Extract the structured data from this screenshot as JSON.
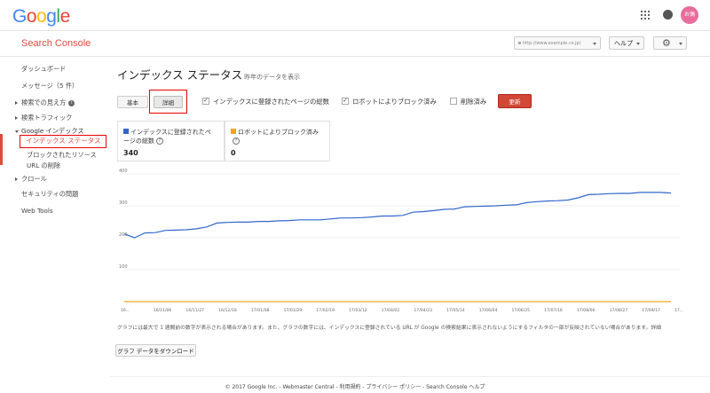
{
  "topbar": {
    "logo": [
      "G",
      "o",
      "o",
      "g",
      "l",
      "e"
    ],
    "logo_colors": [
      "#4285f4",
      "#ea4335",
      "#fbbc05",
      "#4285f4",
      "#34a853",
      "#ea4335"
    ],
    "avatar_text": "お偶"
  },
  "subbar": {
    "title": "Search Console",
    "site_selector": "http://www.example.co.jp/",
    "help_label": "ヘルプ"
  },
  "sidebar": {
    "items": [
      {
        "label": "ダッシュボード"
      },
      {
        "label": "メッセージ（5 件）"
      },
      {
        "label": "検索での見え方"
      },
      {
        "label": "検索トラフィック"
      },
      {
        "label": "Google インデックス"
      },
      {
        "label": "インデックス ステータス"
      },
      {
        "label": "ブロックされたリソース"
      },
      {
        "label": "URL の削除"
      },
      {
        "label": "クロール"
      },
      {
        "label": "セキュリティの問題"
      },
      {
        "label": "Web Tools"
      }
    ]
  },
  "main": {
    "title": "インデックス ステータス",
    "subtitle": "昨年のデータを表示",
    "tab_basic": "基本",
    "tab_detail": "詳細",
    "checkboxes": [
      {
        "label": "インデックスに登録されたページの総数",
        "checked": true
      },
      {
        "label": "ロボットによりブロック済み",
        "checked": true
      },
      {
        "label": "削除済み",
        "checked": false
      }
    ],
    "update_label": "更新",
    "legend": [
      {
        "label_line1": "インデックスに登録されたペ",
        "label_line2": "ージの総数",
        "value": "340",
        "color": "#3366cc"
      },
      {
        "label_line1": "ロボットによりブロック済み",
        "label_line2": "",
        "value": "0",
        "color": "#f4a31a"
      }
    ],
    "note": "グラフには最大で 1 週間前の数字が表示される場合があります。また、グラフの数字には、インデックスに登録されている URL が Google の検索結果に表示されないようにするフィルタの一部が反映されていない場合があります。詳細",
    "download_label": "グラフ データをダウンロード"
  },
  "footer": "© 2017 Google Inc. - Webmaster Central - 利用規約 - プライバシー ポリシー - Search Console ヘルプ",
  "chart_data": {
    "type": "line",
    "ylim": [
      0,
      400
    ],
    "yticks": [
      "400",
      "300",
      "200",
      "100"
    ],
    "xticks": [
      "16...",
      "16/11/06",
      "16/11/27",
      "16/12/18",
      "17/01/08",
      "17/01/29",
      "17/02/19",
      "17/03/12",
      "17/04/02",
      "17/04/23",
      "17/05/14",
      "17/06/04",
      "17/06/25",
      "17/07/16",
      "17/08/06",
      "17/08/27",
      "17/09/17",
      "17..."
    ],
    "series": [
      {
        "color": "#3366cc",
        "values": [
          212,
          200,
          215,
          216,
          223,
          224,
          225,
          228,
          234,
          246,
          248,
          249,
          249,
          251,
          251,
          253,
          254,
          256,
          256,
          256,
          259,
          262,
          262,
          263,
          265,
          268,
          268,
          270,
          280,
          282,
          285,
          289,
          290,
          297,
          298,
          299,
          300,
          302,
          303,
          310,
          313,
          315,
          316,
          318,
          325,
          335,
          336,
          338,
          339,
          339,
          342,
          342,
          342,
          340
        ]
      },
      {
        "color": "#f4a31a",
        "values": [
          0,
          0,
          0,
          0,
          0,
          0,
          0,
          0,
          0,
          0,
          0,
          0,
          0,
          0,
          0,
          0,
          0,
          0,
          0,
          0,
          0,
          0,
          0,
          0,
          0,
          0,
          0,
          0,
          0,
          0,
          0,
          0,
          0,
          0,
          0,
          0,
          0,
          0,
          0,
          0,
          0,
          0,
          0,
          0,
          0,
          0,
          0,
          0,
          0,
          0,
          0,
          0,
          0,
          0
        ]
      }
    ]
  }
}
